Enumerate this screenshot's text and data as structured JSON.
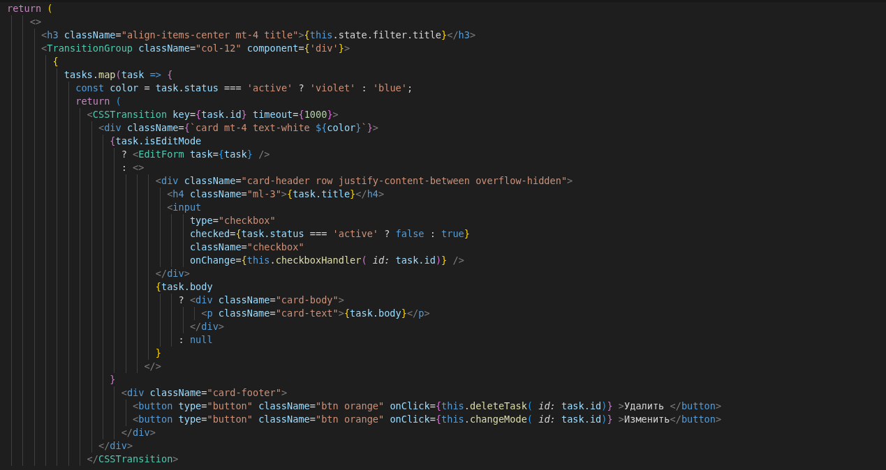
{
  "editor": {
    "lines": [
      {
        "tokens": [
          {
            "kind": "control",
            "text": "return"
          },
          {
            "kind": "brace",
            "text": " ("
          }
        ]
      },
      {
        "tokens": [
          {
            "kind": "punct",
            "text": "    <>"
          }
        ]
      },
      {
        "tokens": [
          {
            "kind": "punct",
            "text": "      <"
          },
          {
            "kind": "tag",
            "text": "h3"
          },
          {
            "kind": "attribute",
            "text": " className"
          },
          {
            "kind": "plain",
            "text": "="
          },
          {
            "kind": "string",
            "text": "\"align-items-center mt-4 title\""
          },
          {
            "kind": "punct",
            "text": ">"
          },
          {
            "kind": "brace",
            "text": "{"
          },
          {
            "kind": "storage",
            "text": "this"
          },
          {
            "kind": "plain",
            "text": ".state.filter.title"
          },
          {
            "kind": "brace",
            "text": "}"
          },
          {
            "kind": "punct",
            "text": "</"
          },
          {
            "kind": "tag",
            "text": "h3"
          },
          {
            "kind": "punct",
            "text": ">"
          }
        ]
      },
      {
        "tokens": [
          {
            "kind": "punct",
            "text": "      <"
          },
          {
            "kind": "component",
            "text": "TransitionGroup"
          },
          {
            "kind": "attribute",
            "text": " className"
          },
          {
            "kind": "plain",
            "text": "="
          },
          {
            "kind": "string",
            "text": "\"col-12\""
          },
          {
            "kind": "attribute",
            "text": " component"
          },
          {
            "kind": "plain",
            "text": "="
          },
          {
            "kind": "brace",
            "text": "{"
          },
          {
            "kind": "string",
            "text": "'div'"
          },
          {
            "kind": "brace",
            "text": "}"
          },
          {
            "kind": "punct",
            "text": ">"
          }
        ]
      },
      {
        "tokens": [
          {
            "kind": "brace",
            "text": "        {"
          }
        ]
      },
      {
        "tokens": [
          {
            "kind": "variable",
            "text": "          tasks"
          },
          {
            "kind": "plain",
            "text": "."
          },
          {
            "kind": "function",
            "text": "map"
          },
          {
            "kind": "bracket",
            "text": "("
          },
          {
            "kind": "variable",
            "text": "task"
          },
          {
            "kind": "storage",
            "text": " =>"
          },
          {
            "kind": "bracket",
            "text": " {"
          }
        ]
      },
      {
        "tokens": [
          {
            "kind": "storage",
            "text": "            const"
          },
          {
            "kind": "variable",
            "text": " color"
          },
          {
            "kind": "plain",
            "text": " = "
          },
          {
            "kind": "variable",
            "text": "task"
          },
          {
            "kind": "plain",
            "text": "."
          },
          {
            "kind": "variable",
            "text": "status"
          },
          {
            "kind": "plain",
            "text": " === "
          },
          {
            "kind": "string",
            "text": "'active'"
          },
          {
            "kind": "plain",
            "text": " ? "
          },
          {
            "kind": "string",
            "text": "'violet'"
          },
          {
            "kind": "plain",
            "text": " : "
          },
          {
            "kind": "string",
            "text": "'blue'"
          },
          {
            "kind": "plain",
            "text": ";"
          }
        ]
      },
      {
        "tokens": [
          {
            "kind": "control",
            "text": "            return"
          },
          {
            "kind": "paren",
            "text": " ("
          }
        ]
      },
      {
        "tokens": [
          {
            "kind": "punct",
            "text": "              <"
          },
          {
            "kind": "component",
            "text": "CSSTransition"
          },
          {
            "kind": "attribute",
            "text": " key"
          },
          {
            "kind": "plain",
            "text": "="
          },
          {
            "kind": "bracket",
            "text": "{"
          },
          {
            "kind": "variable",
            "text": "task.id"
          },
          {
            "kind": "bracket",
            "text": "}"
          },
          {
            "kind": "attribute",
            "text": " timeout"
          },
          {
            "kind": "plain",
            "text": "="
          },
          {
            "kind": "bracket",
            "text": "{"
          },
          {
            "kind": "number",
            "text": "1000"
          },
          {
            "kind": "bracket",
            "text": "}"
          },
          {
            "kind": "punct",
            "text": ">"
          }
        ]
      },
      {
        "tokens": [
          {
            "kind": "punct",
            "text": "                <"
          },
          {
            "kind": "tag",
            "text": "div"
          },
          {
            "kind": "attribute",
            "text": " className"
          },
          {
            "kind": "plain",
            "text": "="
          },
          {
            "kind": "bracket",
            "text": "{"
          },
          {
            "kind": "string",
            "text": "`card mt-4 text-white "
          },
          {
            "kind": "storage",
            "text": "${"
          },
          {
            "kind": "variable",
            "text": "color"
          },
          {
            "kind": "storage",
            "text": "}"
          },
          {
            "kind": "string",
            "text": "`"
          },
          {
            "kind": "bracket",
            "text": "}"
          },
          {
            "kind": "punct",
            "text": ">"
          }
        ]
      },
      {
        "tokens": [
          {
            "kind": "bracket",
            "text": "                  {"
          },
          {
            "kind": "variable",
            "text": "task.isEditMode"
          }
        ]
      },
      {
        "tokens": [
          {
            "kind": "plain",
            "text": "                    ? "
          },
          {
            "kind": "punct",
            "text": "<"
          },
          {
            "kind": "component",
            "text": "EditForm"
          },
          {
            "kind": "attribute",
            "text": " task"
          },
          {
            "kind": "plain",
            "text": "="
          },
          {
            "kind": "paren",
            "text": "{"
          },
          {
            "kind": "variable",
            "text": "task"
          },
          {
            "kind": "paren",
            "text": "}"
          },
          {
            "kind": "punct",
            "text": " />"
          }
        ]
      },
      {
        "tokens": [
          {
            "kind": "plain",
            "text": "                    : "
          },
          {
            "kind": "punct",
            "text": "<>"
          }
        ]
      },
      {
        "tokens": [
          {
            "kind": "punct",
            "text": "                          <"
          },
          {
            "kind": "tag",
            "text": "div"
          },
          {
            "kind": "attribute",
            "text": " className"
          },
          {
            "kind": "plain",
            "text": "="
          },
          {
            "kind": "string",
            "text": "\"card-header row justify-content-between overflow-hidden\""
          },
          {
            "kind": "punct",
            "text": ">"
          }
        ]
      },
      {
        "tokens": [
          {
            "kind": "punct",
            "text": "                            <"
          },
          {
            "kind": "tag",
            "text": "h4"
          },
          {
            "kind": "attribute",
            "text": " className"
          },
          {
            "kind": "plain",
            "text": "="
          },
          {
            "kind": "string",
            "text": "\"ml-3\""
          },
          {
            "kind": "punct",
            "text": ">"
          },
          {
            "kind": "brace",
            "text": "{"
          },
          {
            "kind": "variable",
            "text": "task.title"
          },
          {
            "kind": "brace",
            "text": "}"
          },
          {
            "kind": "punct",
            "text": "</"
          },
          {
            "kind": "tag",
            "text": "h4"
          },
          {
            "kind": "punct",
            "text": ">"
          }
        ]
      },
      {
        "tokens": [
          {
            "kind": "punct",
            "text": "                            <"
          },
          {
            "kind": "tag",
            "text": "input"
          }
        ]
      },
      {
        "tokens": [
          {
            "kind": "attribute",
            "text": "                                type"
          },
          {
            "kind": "plain",
            "text": "="
          },
          {
            "kind": "string",
            "text": "\"checkbox\""
          }
        ]
      },
      {
        "tokens": [
          {
            "kind": "attribute",
            "text": "                                checked"
          },
          {
            "kind": "plain",
            "text": "="
          },
          {
            "kind": "brace",
            "text": "{"
          },
          {
            "kind": "variable",
            "text": "task.status"
          },
          {
            "kind": "plain",
            "text": " === "
          },
          {
            "kind": "string",
            "text": "'active'"
          },
          {
            "kind": "plain",
            "text": " ? "
          },
          {
            "kind": "storage",
            "text": "false"
          },
          {
            "kind": "plain",
            "text": " : "
          },
          {
            "kind": "storage",
            "text": "true"
          },
          {
            "kind": "brace",
            "text": "}"
          }
        ]
      },
      {
        "tokens": [
          {
            "kind": "attribute",
            "text": "                                className"
          },
          {
            "kind": "plain",
            "text": "="
          },
          {
            "kind": "string",
            "text": "\"checkbox\""
          }
        ]
      },
      {
        "tokens": [
          {
            "kind": "attribute",
            "text": "                                onChange"
          },
          {
            "kind": "plain",
            "text": "="
          },
          {
            "kind": "brace",
            "text": "{"
          },
          {
            "kind": "storage",
            "text": "this"
          },
          {
            "kind": "plain",
            "text": "."
          },
          {
            "kind": "function",
            "text": "checkboxHandler"
          },
          {
            "kind": "bracket",
            "text": "("
          },
          {
            "kind": "hint",
            "text": " id:"
          },
          {
            "kind": "variable",
            "text": " task.id"
          },
          {
            "kind": "bracket",
            "text": ")"
          },
          {
            "kind": "brace",
            "text": "}"
          },
          {
            "kind": "punct",
            "text": " />"
          }
        ]
      },
      {
        "tokens": [
          {
            "kind": "punct",
            "text": "                          </"
          },
          {
            "kind": "tag",
            "text": "div"
          },
          {
            "kind": "punct",
            "text": ">"
          }
        ]
      },
      {
        "tokens": [
          {
            "kind": "brace",
            "text": "                          {"
          },
          {
            "kind": "variable",
            "text": "task.body"
          }
        ]
      },
      {
        "tokens": [
          {
            "kind": "plain",
            "text": "                              ? "
          },
          {
            "kind": "punct",
            "text": "<"
          },
          {
            "kind": "tag",
            "text": "div"
          },
          {
            "kind": "attribute",
            "text": " className"
          },
          {
            "kind": "plain",
            "text": "="
          },
          {
            "kind": "string",
            "text": "\"card-body\""
          },
          {
            "kind": "punct",
            "text": ">"
          }
        ]
      },
      {
        "tokens": [
          {
            "kind": "punct",
            "text": "                                  <"
          },
          {
            "kind": "tag",
            "text": "p"
          },
          {
            "kind": "attribute",
            "text": " className"
          },
          {
            "kind": "plain",
            "text": "="
          },
          {
            "kind": "string",
            "text": "\"card-text\""
          },
          {
            "kind": "punct",
            "text": ">"
          },
          {
            "kind": "brace",
            "text": "{"
          },
          {
            "kind": "variable",
            "text": "task.body"
          },
          {
            "kind": "brace",
            "text": "}"
          },
          {
            "kind": "punct",
            "text": "</"
          },
          {
            "kind": "tag",
            "text": "p"
          },
          {
            "kind": "punct",
            "text": ">"
          }
        ]
      },
      {
        "tokens": [
          {
            "kind": "punct",
            "text": "                                </"
          },
          {
            "kind": "tag",
            "text": "div"
          },
          {
            "kind": "punct",
            "text": ">"
          }
        ]
      },
      {
        "tokens": [
          {
            "kind": "plain",
            "text": "                              : "
          },
          {
            "kind": "storage",
            "text": "null"
          }
        ]
      },
      {
        "tokens": [
          {
            "kind": "brace",
            "text": "                          }"
          }
        ]
      },
      {
        "tokens": [
          {
            "kind": "punct",
            "text": "                        </>"
          }
        ]
      },
      {
        "tokens": [
          {
            "kind": "bracket",
            "text": "                  }"
          }
        ]
      },
      {
        "tokens": [
          {
            "kind": "punct",
            "text": "                    <"
          },
          {
            "kind": "tag",
            "text": "div"
          },
          {
            "kind": "attribute",
            "text": " className"
          },
          {
            "kind": "plain",
            "text": "="
          },
          {
            "kind": "string",
            "text": "\"card-footer\""
          },
          {
            "kind": "punct",
            "text": ">"
          }
        ]
      },
      {
        "tokens": [
          {
            "kind": "punct",
            "text": "                      <"
          },
          {
            "kind": "tag",
            "text": "button"
          },
          {
            "kind": "attribute",
            "text": " type"
          },
          {
            "kind": "plain",
            "text": "="
          },
          {
            "kind": "string",
            "text": "\"button\""
          },
          {
            "kind": "attribute",
            "text": " className"
          },
          {
            "kind": "plain",
            "text": "="
          },
          {
            "kind": "string",
            "text": "\"btn orange\""
          },
          {
            "kind": "attribute",
            "text": " onClick"
          },
          {
            "kind": "plain",
            "text": "="
          },
          {
            "kind": "bracket",
            "text": "{"
          },
          {
            "kind": "storage",
            "text": "this"
          },
          {
            "kind": "plain",
            "text": "."
          },
          {
            "kind": "function",
            "text": "deleteTask"
          },
          {
            "kind": "paren",
            "text": "("
          },
          {
            "kind": "hint",
            "text": " id:"
          },
          {
            "kind": "variable",
            "text": " task.id"
          },
          {
            "kind": "paren",
            "text": ")"
          },
          {
            "kind": "bracket",
            "text": "}"
          },
          {
            "kind": "punct",
            "text": " >"
          },
          {
            "kind": "plain",
            "text": "Удалить "
          },
          {
            "kind": "punct",
            "text": "</"
          },
          {
            "kind": "tag",
            "text": "button"
          },
          {
            "kind": "punct",
            "text": ">"
          }
        ]
      },
      {
        "tokens": [
          {
            "kind": "punct",
            "text": "                      <"
          },
          {
            "kind": "tag",
            "text": "button"
          },
          {
            "kind": "attribute",
            "text": " type"
          },
          {
            "kind": "plain",
            "text": "="
          },
          {
            "kind": "string",
            "text": "\"button\""
          },
          {
            "kind": "attribute",
            "text": " className"
          },
          {
            "kind": "plain",
            "text": "="
          },
          {
            "kind": "string",
            "text": "\"btn orange\""
          },
          {
            "kind": "attribute",
            "text": " onClick"
          },
          {
            "kind": "plain",
            "text": "="
          },
          {
            "kind": "bracket",
            "text": "{"
          },
          {
            "kind": "storage",
            "text": "this"
          },
          {
            "kind": "plain",
            "text": "."
          },
          {
            "kind": "function",
            "text": "changeMode"
          },
          {
            "kind": "paren",
            "text": "("
          },
          {
            "kind": "hint",
            "text": " id:"
          },
          {
            "kind": "variable",
            "text": " task.id"
          },
          {
            "kind": "paren",
            "text": ")"
          },
          {
            "kind": "bracket",
            "text": "}"
          },
          {
            "kind": "punct",
            "text": " >"
          },
          {
            "kind": "plain",
            "text": "Изменить"
          },
          {
            "kind": "punct",
            "text": "</"
          },
          {
            "kind": "tag",
            "text": "button"
          },
          {
            "kind": "punct",
            "text": ">"
          }
        ]
      },
      {
        "tokens": [
          {
            "kind": "punct",
            "text": "                    </"
          },
          {
            "kind": "tag",
            "text": "div"
          },
          {
            "kind": "punct",
            "text": ">"
          }
        ]
      },
      {
        "tokens": [
          {
            "kind": "punct",
            "text": "                </"
          },
          {
            "kind": "tag",
            "text": "div"
          },
          {
            "kind": "punct",
            "text": ">"
          }
        ]
      },
      {
        "tokens": [
          {
            "kind": "punct",
            "text": "              </"
          },
          {
            "kind": "component",
            "text": "CSSTransition"
          },
          {
            "kind": "punct",
            "text": ">"
          }
        ]
      }
    ]
  }
}
